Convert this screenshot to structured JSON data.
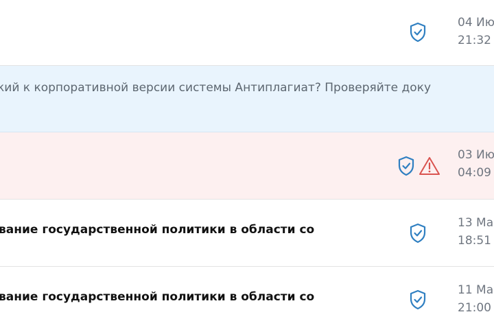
{
  "rows": [
    {
      "date_line1": "04 Ию",
      "date_line2": "21:32"
    },
    {
      "promo_text": "кий к корпоративной версии системы Антиплагиат? Проверяйте доку"
    },
    {
      "date_line1": "03 Ию",
      "date_line2": "04:09"
    },
    {
      "title": "вание государственной политики в области со",
      "date_line1": "13 Ма",
      "date_line2": "18:51"
    },
    {
      "title": "вание государственной политики в области со",
      "date_line1": "11 Ма",
      "date_line2": "21:00"
    }
  ],
  "colors": {
    "shield_icon": "#2f7fc1",
    "warning_icon": "#d9534f",
    "promo_background": "#e9f4fd",
    "flagged_row_background": "#fdf0f0"
  },
  "icons": [
    "shield-check-icon",
    "warning-triangle-icon"
  ]
}
